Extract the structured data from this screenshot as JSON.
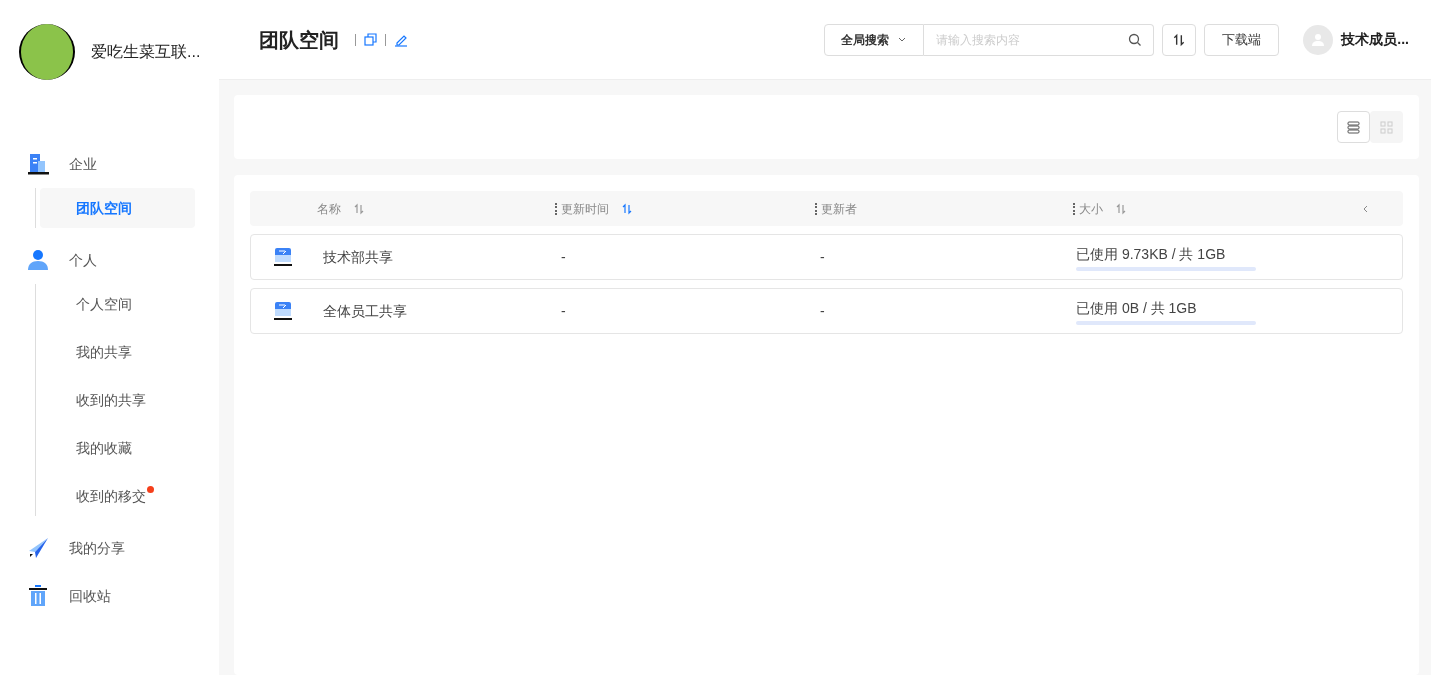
{
  "org": {
    "name": "爱吃生菜互联..."
  },
  "header": {
    "title": "团队空间",
    "search_scope": "全局搜索",
    "search": {
      "placeholder": "请输入搜索内容"
    },
    "download": "下载端",
    "user": "技术成员..."
  },
  "view_toggle": [
    {
      "kind": "list",
      "selected": true
    },
    {
      "kind": "grid",
      "selected": false
    }
  ],
  "sidebar": {
    "items": [
      {
        "label": "企业",
        "kind": "building",
        "children": [
          {
            "label": "团队空间",
            "selected": true,
            "dot": false
          }
        ]
      },
      {
        "label": "个人",
        "kind": "person",
        "children": [
          {
            "label": "个人空间",
            "selected": false,
            "dot": false
          },
          {
            "label": "我的共享",
            "selected": false,
            "dot": false
          },
          {
            "label": "收到的共享",
            "selected": false,
            "dot": false
          },
          {
            "label": "我的收藏",
            "selected": false,
            "dot": false
          },
          {
            "label": "收到的移交",
            "selected": false,
            "dot": true
          }
        ]
      },
      {
        "label": "我的分享",
        "kind": "plane"
      },
      {
        "label": "回收站",
        "kind": "trash"
      }
    ]
  },
  "table": {
    "columns": [
      {
        "label": "名称",
        "sorted": false
      },
      {
        "label": "更新时间",
        "sorted": true
      },
      {
        "label": "更新者"
      },
      {
        "label": "大小",
        "sorted": false
      }
    ],
    "rows": [
      {
        "name": "技术部共享",
        "updated": "-",
        "updater": "-",
        "size": "已使用 9.73KB / 共 1GB"
      },
      {
        "name": "全体员工共享",
        "updated": "-",
        "updater": "-",
        "size": "已使用 0B / 共 1GB"
      }
    ]
  }
}
